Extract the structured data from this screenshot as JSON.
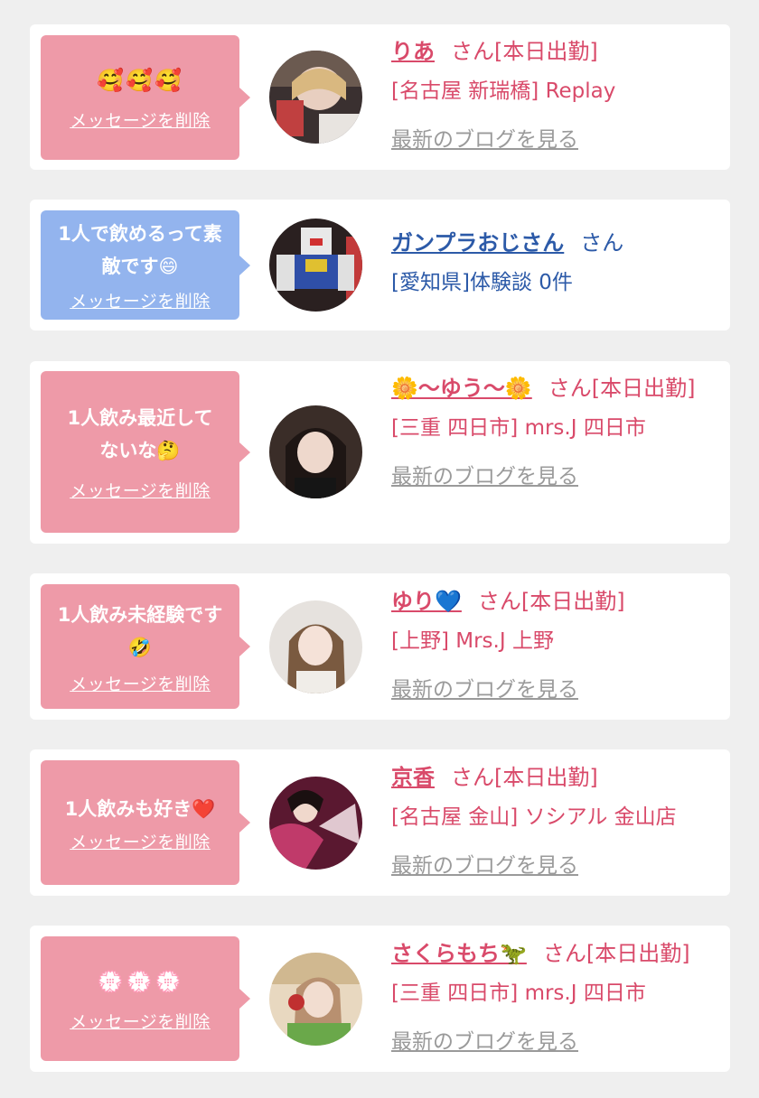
{
  "colors": {
    "pink_bubble": "#ee9aa8",
    "blue_bubble": "#93b4ee",
    "name_pink": "#d94a6a",
    "name_blue": "#2c5aa8",
    "link_gray": "#9a9a9a",
    "background": "#efefef"
  },
  "delete_label": "メッセージを削除",
  "blog_label": "最新のブログを見る",
  "cards": [
    {
      "message": "🥰🥰🥰",
      "name": "りあ",
      "suffix": "さん[本日出勤]",
      "shop": "[名古屋 新瑞橋] Replay",
      "avatar": "avatar-photo-ria"
    },
    {
      "message": "1人で飲めるって素敵です😄",
      "name": "ガンプラおじさん",
      "suffix": "さん",
      "shop": "[愛知県]体験談 0件",
      "avatar": "avatar-photo-gundam"
    },
    {
      "message": "1人飲み最近してないな🤔",
      "name": "🌼〜ゆう〜🌼",
      "suffix": "さん[本日出勤]",
      "shop": "[三重 四日市] mrs.J 四日市",
      "avatar": "avatar-photo-yuu"
    },
    {
      "message": "1人飲み未経験です🤣",
      "name": "ゆり💙",
      "suffix": "さん[本日出勤]",
      "shop": "[上野] Mrs.J 上野",
      "avatar": "avatar-photo-yuri"
    },
    {
      "message": "1人飲みも好き❤️",
      "name": "京香",
      "suffix": "さん[本日出勤]",
      "shop": "[名古屋 金山] ソシアル 金山店",
      "avatar": "avatar-photo-kyouka"
    },
    {
      "message": "💮💮💮",
      "name": "さくらもち🦖",
      "suffix": "さん[本日出勤]",
      "shop": "[三重 四日市] mrs.J 四日市",
      "avatar": "avatar-photo-sakuramochi"
    }
  ]
}
